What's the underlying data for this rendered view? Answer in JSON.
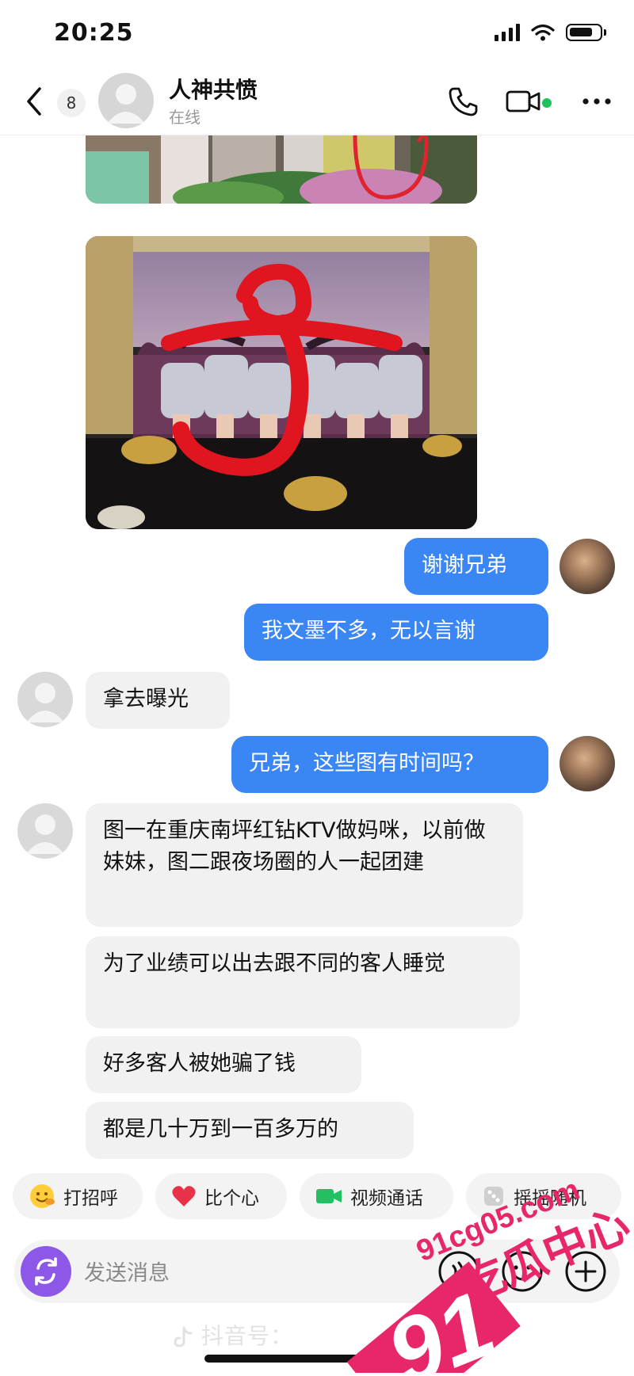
{
  "status_bar": {
    "time": "20:25"
  },
  "header": {
    "unread_count": "8",
    "contact_name": "人神共愤",
    "contact_status": "在线"
  },
  "messages": {
    "out_1": "谢谢兄弟",
    "out_2": "我文墨不多，无以言谢",
    "in_1": "拿去曝光",
    "out_3": "兄弟，这些图有时间吗？",
    "in_2": "图一在重庆南坪红钻KTV做妈咪，以前做妹妹，图二跟夜场圈的人一起团建",
    "in_3": "为了业绩可以出去跟不同的客人睡觉",
    "in_4": "好多客人被她骗了钱",
    "in_5": "都是几十万到一百多万的"
  },
  "quick_actions": {
    "greet": "打招呼",
    "heart": "比个心",
    "video_call": "视频通话",
    "shake": "摇摇随机"
  },
  "input": {
    "placeholder": "发送消息"
  },
  "footer": {
    "watermark_text": "抖音号："
  },
  "overlay_watermark": {
    "number": "91",
    "url": "91cg05.com",
    "brand": "吃瓜中心"
  },
  "colors": {
    "outgoing_bubble": "#3a86f5",
    "incoming_bubble": "#f1f1f1",
    "online": "#20c05a",
    "watermark": "#e8276b"
  }
}
